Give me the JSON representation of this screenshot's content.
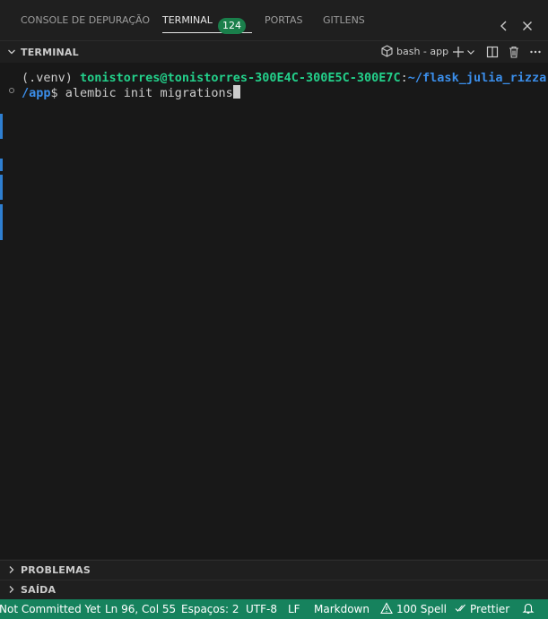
{
  "tabs": [
    {
      "label": "CONSOLE DE DEPURAÇÃO"
    },
    {
      "label": "TERMINAL",
      "badge": "124"
    },
    {
      "label": "PORTAS"
    },
    {
      "label": "GITLENS"
    }
  ],
  "section": {
    "title": "TERMINAL"
  },
  "terminal_toolbar": {
    "shell_label": "bash - app"
  },
  "terminal": {
    "venv": "(.venv) ",
    "user_host": "tonistorres@tonistorres-300E4C-300E5C-300E7C",
    "colon": ":",
    "path_line1": "~/flask_julia_rizza",
    "path_line2": "/app",
    "prompt_symbol": "$ ",
    "command": "alembic init migrations"
  },
  "panels": [
    {
      "label": "PROBLEMAS"
    },
    {
      "label": "SAÍDA"
    }
  ],
  "statusbar": {
    "git": "Not Committed Yet",
    "position": "Ln 96, Col 55",
    "indent": "Espaços: 2",
    "encoding": "UTF-8",
    "eol": "LF",
    "language": "Markdown",
    "spell": "100 Spell",
    "prettier": "Prettier"
  },
  "colors": {
    "status_bg": "#16825d",
    "badge_bg": "#1a7f4b",
    "user": "#23d18b",
    "path": "#3b8eea"
  }
}
